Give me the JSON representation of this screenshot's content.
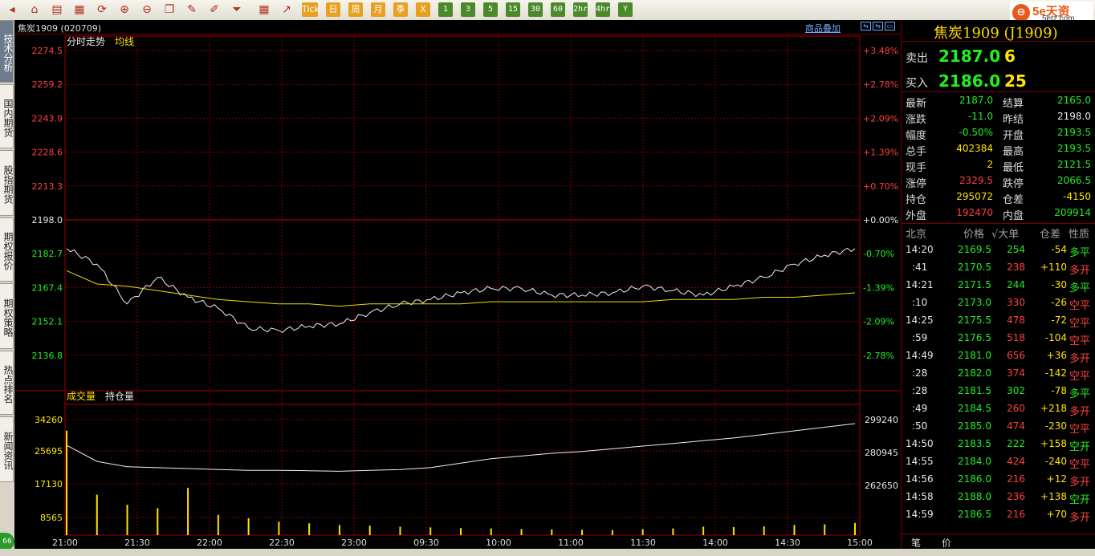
{
  "toolbar": {
    "buttons": [
      {
        "icon": "back-icon",
        "glyph": "◂"
      },
      {
        "icon": "home-icon",
        "glyph": "⌂"
      },
      {
        "icon": "document-icon",
        "glyph": "▤"
      },
      {
        "icon": "calendar-icon",
        "glyph": "▦"
      },
      {
        "icon": "refresh-icon",
        "glyph": "⟳"
      },
      {
        "icon": "zoom-in-icon",
        "glyph": "⊕"
      },
      {
        "icon": "zoom-out-icon",
        "glyph": "⊖"
      },
      {
        "icon": "windows-icon",
        "glyph": "❐"
      },
      {
        "icon": "pencil-icon",
        "glyph": "✎"
      },
      {
        "icon": "brush-icon",
        "glyph": "✐"
      },
      {
        "icon": "filter-icon",
        "glyph": "⏷"
      }
    ],
    "view_buttons": [
      {
        "icon": "table-icon",
        "glyph": "▦"
      },
      {
        "icon": "line-chart-icon",
        "glyph": "↗"
      }
    ],
    "tick_label": "Tick",
    "period_buttons": [
      "日",
      "周",
      "月",
      "季",
      "X"
    ],
    "minute_buttons": [
      "1",
      "3",
      "5",
      "15",
      "30",
      "60",
      "2hr",
      "4hr",
      "Y"
    ]
  },
  "logo": {
    "mark": "⊖",
    "text": "5e天资",
    "sub": "5etz.com"
  },
  "side_tabs": [
    "技术分析",
    "国内期货",
    "股指期货",
    "期权报价",
    "期权策略",
    "热点排名",
    "新闻资讯"
  ],
  "badge": "66",
  "chart": {
    "symbol_code": "焦炭1909 (020709)",
    "overlay_link": "商品叠加",
    "win_controls": [
      "⇆",
      "⇆",
      "▭"
    ],
    "top_legend": {
      "a": "分时走势",
      "b": "均线"
    },
    "price_labels": [
      "2274.5",
      "2259.2",
      "2243.9",
      "2228.6",
      "2213.3",
      "2198.0",
      "2182.7",
      "2167.4",
      "2152.1",
      "2136.8"
    ],
    "pct_labels": [
      "+3.48%",
      "+2.78%",
      "+2.09%",
      "+1.39%",
      "+0.70%",
      "+0.00%",
      "-0.70%",
      "-1.39%",
      "-2.09%",
      "-2.78%"
    ],
    "bottom_legend": {
      "a": "成交量",
      "b": "持仓量"
    },
    "vol_labels": [
      "34260",
      "25695",
      "17130",
      "8565"
    ],
    "oi_labels": [
      "299240",
      "280945",
      "262650"
    ],
    "time_labels": [
      "21:00",
      "21:30",
      "22:00",
      "22:30",
      "23:00",
      "09:30",
      "10:00",
      "11:00",
      "11:30",
      "14:00",
      "14:30",
      "15:00"
    ]
  },
  "chart_data": {
    "type": "line",
    "x_ticks": [
      "21:00",
      "21:30",
      "22:00",
      "22:30",
      "23:00",
      "09:30",
      "10:00",
      "11:00",
      "11:30",
      "14:00",
      "14:30",
      "15:00"
    ],
    "price_ylim": [
      2136.8,
      2274.5
    ],
    "prev_settle": 2198.0,
    "series": [
      {
        "values": [
          2185,
          2178,
          2160,
          2172,
          2163,
          2158,
          2149,
          2148,
          2150,
          2151,
          2156,
          2160,
          2162,
          2165,
          2167,
          2167,
          2164,
          2164,
          2165,
          2168,
          2166,
          2164,
          2168,
          2172,
          2178,
          2182,
          2185
        ]
      },
      {
        "values": [
          2175,
          2169,
          2168,
          2166,
          2164,
          2162,
          2161,
          2160,
          2160,
          2159,
          2160,
          2160,
          2160,
          2160,
          2161,
          2161,
          2161,
          2161,
          2161,
          2161,
          2162,
          2162,
          2162,
          2163,
          2163,
          2164,
          2165
        ]
      }
    ],
    "volume_ylim": [
      0,
      34260
    ],
    "oi_ylim": [
      262650,
      299240
    ],
    "open_interest": [
      285000,
      276000,
      273000,
      272500,
      272000,
      271500,
      271000,
      271000,
      270800,
      270500,
      271000,
      271500,
      272500,
      275000,
      277500,
      279000,
      280500,
      281500,
      283000,
      284500,
      286000,
      287500,
      289000,
      291000,
      293000,
      295000,
      297000
    ],
    "volume": [
      31000,
      12000,
      9000,
      8000,
      14000,
      6000,
      5000,
      4000,
      3500,
      3000,
      2800,
      2500,
      2300,
      2100,
      2000,
      1800,
      1700,
      1600,
      1500,
      1800,
      2000,
      2500,
      2400,
      2600,
      3000,
      3200,
      3600
    ]
  },
  "quote": {
    "title": "焦炭1909 (J1909)",
    "sell": {
      "label": "卖出",
      "price": "2187.0",
      "qty": "6"
    },
    "buy": {
      "label": "买入",
      "price": "2186.0",
      "qty": "25"
    },
    "stats": [
      {
        "l1": "最新",
        "v1": "2187.0",
        "c1": "g",
        "l2": "结算",
        "v2": "2165.0",
        "c2": "g"
      },
      {
        "l1": "涨跌",
        "v1": "-11.0",
        "c1": "g",
        "l2": "昨结",
        "v2": "2198.0",
        "c2": "w"
      },
      {
        "l1": "幅度",
        "v1": "-0.50%",
        "c1": "g",
        "l2": "开盘",
        "v2": "2193.5",
        "c2": "g"
      },
      {
        "l1": "总手",
        "v1": "402384",
        "c1": "y",
        "l2": "最高",
        "v2": "2193.5",
        "c2": "g"
      },
      {
        "l1": "现手",
        "v1": "2",
        "c1": "y",
        "l2": "最低",
        "v2": "2121.5",
        "c2": "g"
      },
      {
        "l1": "涨停",
        "v1": "2329.5",
        "c1": "r",
        "l2": "跌停",
        "v2": "2066.5",
        "c2": "g"
      },
      {
        "l1": "持仓",
        "v1": "295072",
        "c1": "y",
        "l2": "仓差",
        "v2": "-4150",
        "c2": "y"
      },
      {
        "l1": "外盘",
        "v1": "192470",
        "c1": "r",
        "l2": "内盘",
        "v2": "209914",
        "c2": "g"
      }
    ],
    "tick_headers": {
      "time": "北京",
      "price": "价格",
      "vol": "√大单",
      "oi": "仓差",
      "type": "性质"
    },
    "ticks": [
      {
        "t": "14:20",
        "p": "2169.5",
        "v": "254",
        "vc": "g",
        "o": "-54",
        "oc": "y",
        "k": "多平",
        "kc": "g"
      },
      {
        "t": ":41",
        "p": "2170.5",
        "v": "238",
        "vc": "r",
        "o": "+110",
        "oc": "y",
        "k": "多开",
        "kc": "r"
      },
      {
        "t": "14:21",
        "p": "2171.5",
        "v": "244",
        "vc": "g",
        "o": "-30",
        "oc": "y",
        "k": "多平",
        "kc": "g"
      },
      {
        "t": ":10",
        "p": "2173.0",
        "v": "330",
        "vc": "r",
        "o": "-26",
        "oc": "y",
        "k": "空平",
        "kc": "r"
      },
      {
        "t": "14:25",
        "p": "2175.5",
        "v": "478",
        "vc": "r",
        "o": "-72",
        "oc": "y",
        "k": "空平",
        "kc": "r"
      },
      {
        "t": ":59",
        "p": "2176.5",
        "v": "518",
        "vc": "r",
        "o": "-104",
        "oc": "y",
        "k": "空平",
        "kc": "r"
      },
      {
        "t": "14:49",
        "p": "2181.0",
        "v": "656",
        "vc": "r",
        "o": "+36",
        "oc": "y",
        "k": "多开",
        "kc": "r"
      },
      {
        "t": ":28",
        "p": "2182.0",
        "v": "374",
        "vc": "r",
        "o": "-142",
        "oc": "y",
        "k": "空平",
        "kc": "r"
      },
      {
        "t": ":28",
        "p": "2181.5",
        "v": "302",
        "vc": "g",
        "o": "-78",
        "oc": "y",
        "k": "多平",
        "kc": "g"
      },
      {
        "t": ":49",
        "p": "2184.5",
        "v": "260",
        "vc": "r",
        "o": "+218",
        "oc": "y",
        "k": "多开",
        "kc": "r"
      },
      {
        "t": ":50",
        "p": "2185.0",
        "v": "474",
        "vc": "r",
        "o": "-230",
        "oc": "y",
        "k": "空平",
        "kc": "r"
      },
      {
        "t": "14:50",
        "p": "2183.5",
        "v": "222",
        "vc": "g",
        "o": "+158",
        "oc": "y",
        "k": "空开",
        "kc": "g"
      },
      {
        "t": "14:55",
        "p": "2184.0",
        "v": "424",
        "vc": "r",
        "o": "-240",
        "oc": "y",
        "k": "空平",
        "kc": "r"
      },
      {
        "t": "14:56",
        "p": "2186.0",
        "v": "216",
        "vc": "r",
        "o": "+12",
        "oc": "y",
        "k": "多开",
        "kc": "r"
      },
      {
        "t": "14:58",
        "p": "2188.0",
        "v": "236",
        "vc": "r",
        "o": "+138",
        "oc": "y",
        "k": "空开",
        "kc": "g"
      },
      {
        "t": "14:59",
        "p": "2186.5",
        "v": "216",
        "vc": "r",
        "o": "+70",
        "oc": "y",
        "k": "多开",
        "kc": "r"
      }
    ],
    "tabs": [
      "笔",
      "价"
    ]
  }
}
